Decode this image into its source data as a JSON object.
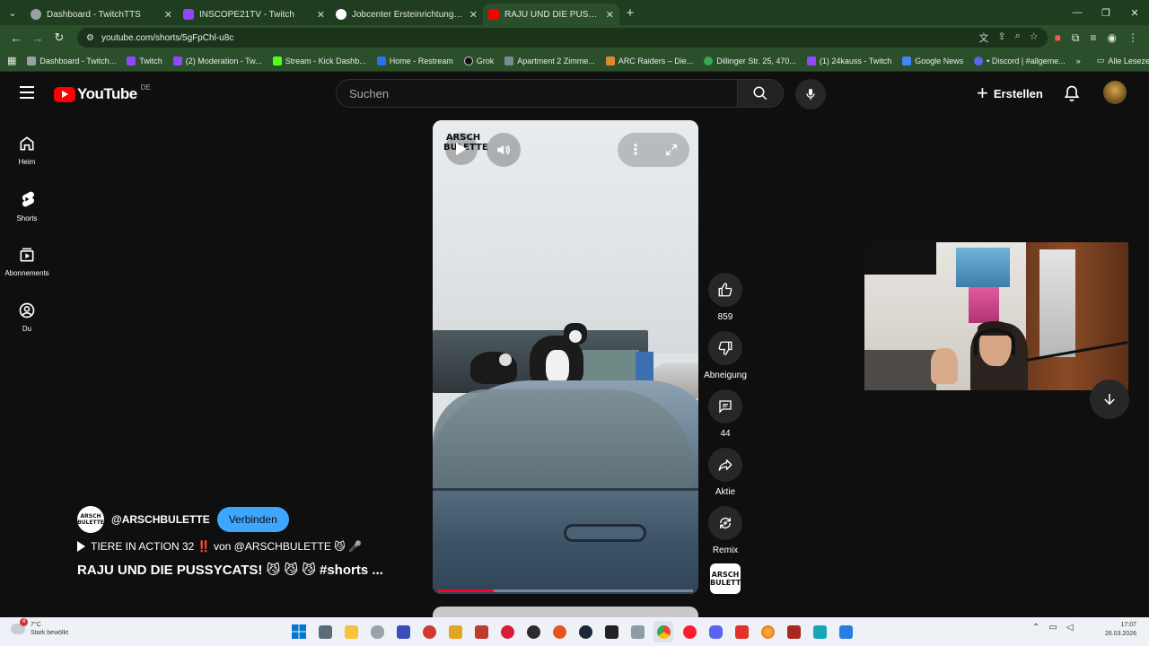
{
  "browser": {
    "tabs": [
      {
        "title": "Dashboard - TwitchTTS",
        "active": false,
        "favicon_color": "#9aa0a6"
      },
      {
        "title": "INSCOPE21TV - Twitch",
        "active": false,
        "favicon_color": "#9147ff"
      },
      {
        "title": "Jobcenter Ersteinrichtung: Betr",
        "active": false,
        "favicon_color": "#ffffff"
      },
      {
        "title": "RAJU UND DIE PUSSYCATS! 😼 !",
        "active": true,
        "favicon_color": "#ff0000"
      }
    ],
    "url": "youtube.com/shorts/5gFpChl-u8c",
    "bookmarks": [
      {
        "label": "Dashboard - Twitch...",
        "color": "#9aa0a6"
      },
      {
        "label": "Twitch",
        "color": "#9147ff"
      },
      {
        "label": "(2) Moderation - Tw...",
        "color": "#9147ff"
      },
      {
        "label": "Stream - Kick Dashb...",
        "color": "#53fc18"
      },
      {
        "label": "Home - Restream",
        "color": "#2f6fed"
      },
      {
        "label": "Grok",
        "color": "#111111"
      },
      {
        "label": "Apartment 2 Zimme...",
        "color": "#7a8a96"
      },
      {
        "label": "ARC Raiders – Die...",
        "color": "#e08a2c"
      },
      {
        "label": "Dillinger Str. 25, 470...",
        "color": "#34a853"
      },
      {
        "label": "(1) 24kauss - Twitch",
        "color": "#9147ff"
      },
      {
        "label": "Google News",
        "color": "#4285f4"
      },
      {
        "label": "• Discord | #allgeme...",
        "color": "#5865f2"
      }
    ],
    "all_bookmarks_label": "Alle Lesezeichen"
  },
  "youtube": {
    "logo_text": "YouTube",
    "country_code": "DE",
    "search_placeholder": "Suchen",
    "create_label": "Erstellen",
    "guide": [
      {
        "label": "Heim",
        "icon": "home-icon"
      },
      {
        "label": "Shorts",
        "icon": "shorts-icon"
      },
      {
        "label": "Abonnements",
        "icon": "subscriptions-icon"
      },
      {
        "label": "Du",
        "icon": "you-icon"
      }
    ]
  },
  "short": {
    "overlay_logo_text": "ARSCH\nBULETTE",
    "progress": 0.22,
    "actions": {
      "likes": "859",
      "dislike_label": "Abneigung",
      "comments": "44",
      "share_label": "Aktie",
      "remix_label": "Remix"
    },
    "channel": {
      "handle": "@ARSCHBULETTE",
      "follow_label": "Verbinden",
      "avatar_text": "ARSCH BULETTE"
    },
    "series_text": "TIERE IN ACTION 32 ‼️ von @ARSCHBULETTE 😼 🎤",
    "title": "RAJU UND DIE PUSSYCATS! 😼 😼 😼 #shorts  ..."
  },
  "taskbar": {
    "weather_temp": "7°C",
    "weather_desc": "Stark bewölkt",
    "notification_count": "4",
    "time": "17:07",
    "date": "26.03.2026"
  }
}
